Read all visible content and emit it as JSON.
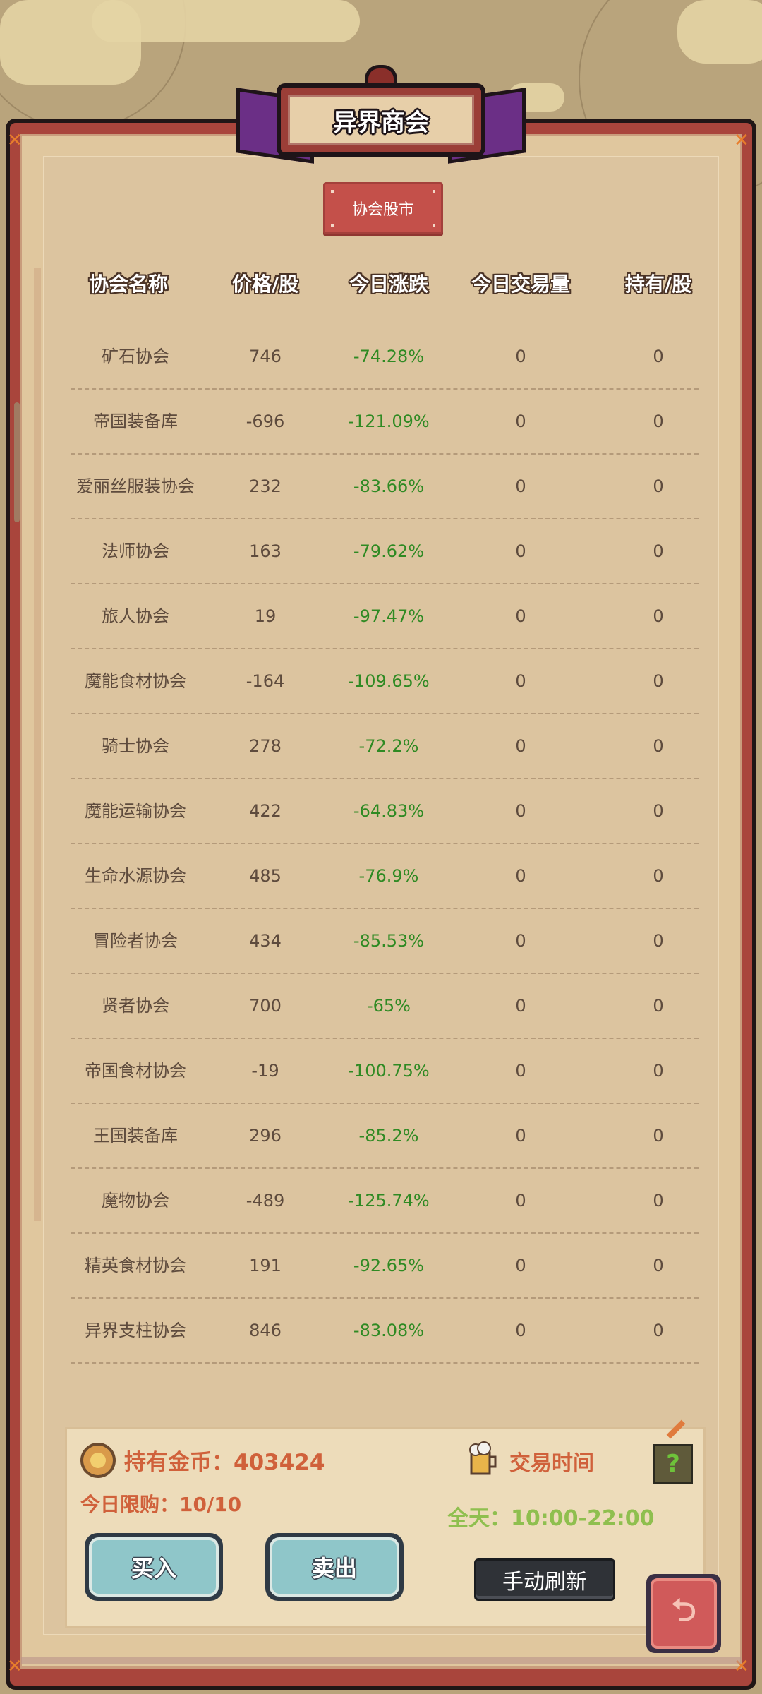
{
  "title": "异界商会",
  "tab": {
    "label": "协会股市"
  },
  "table": {
    "headers": [
      "协会名称",
      "价格/股",
      "今日涨跌",
      "今日交易量",
      "持有/股"
    ],
    "rows": [
      {
        "name": "矿石协会",
        "price": "746",
        "change": "-74.28%",
        "volume": "0",
        "holding": "0"
      },
      {
        "name": "帝国装备库",
        "price": "-696",
        "change": "-121.09%",
        "volume": "0",
        "holding": "0"
      },
      {
        "name": "爱丽丝服装协会",
        "price": "232",
        "change": "-83.66%",
        "volume": "0",
        "holding": "0"
      },
      {
        "name": "法师协会",
        "price": "163",
        "change": "-79.62%",
        "volume": "0",
        "holding": "0"
      },
      {
        "name": "旅人协会",
        "price": "19",
        "change": "-97.47%",
        "volume": "0",
        "holding": "0"
      },
      {
        "name": "魔能食材协会",
        "price": "-164",
        "change": "-109.65%",
        "volume": "0",
        "holding": "0"
      },
      {
        "name": "骑士协会",
        "price": "278",
        "change": "-72.2%",
        "volume": "0",
        "holding": "0"
      },
      {
        "name": "魔能运输协会",
        "price": "422",
        "change": "-64.83%",
        "volume": "0",
        "holding": "0"
      },
      {
        "name": "生命水源协会",
        "price": "485",
        "change": "-76.9%",
        "volume": "0",
        "holding": "0"
      },
      {
        "name": "冒险者协会",
        "price": "434",
        "change": "-85.53%",
        "volume": "0",
        "holding": "0"
      },
      {
        "name": "贤者协会",
        "price": "700",
        "change": "-65%",
        "volume": "0",
        "holding": "0"
      },
      {
        "name": "帝国食材协会",
        "price": "-19",
        "change": "-100.75%",
        "volume": "0",
        "holding": "0"
      },
      {
        "name": "王国装备库",
        "price": "296",
        "change": "-85.2%",
        "volume": "0",
        "holding": "0"
      },
      {
        "name": "魔物协会",
        "price": "-489",
        "change": "-125.74%",
        "volume": "0",
        "holding": "0"
      },
      {
        "name": "精英食材协会",
        "price": "191",
        "change": "-92.65%",
        "volume": "0",
        "holding": "0"
      },
      {
        "name": "异界支柱协会",
        "price": "846",
        "change": "-83.08%",
        "volume": "0",
        "holding": "0"
      }
    ]
  },
  "info": {
    "gold_text": "持有金币：403424",
    "limit_text": "今日限购：10/10",
    "trade_time_label": "交易时间",
    "trade_time_value": "全天：10:00-22:00",
    "help_glyph": "?"
  },
  "buttons": {
    "buy": "买入",
    "sell": "卖出",
    "refresh": "手动刷新",
    "back_glyph": "⮌"
  },
  "colors": {
    "frame": "#a9453c",
    "panel": "#dcc49f",
    "change_negative": "#2f8a23",
    "accent_text": "#d0613b",
    "time_text": "#8fbf4f"
  }
}
